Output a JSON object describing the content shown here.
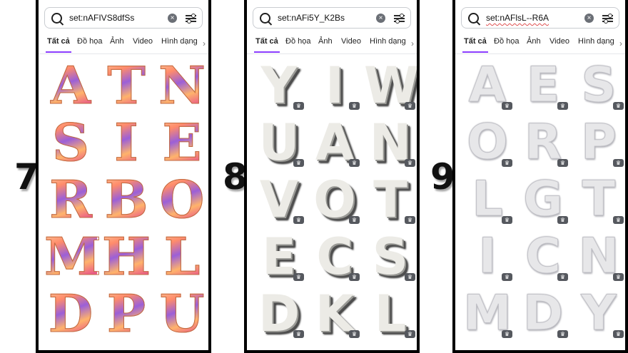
{
  "panels": [
    {
      "number": "7",
      "search_query": "set:nAFIVS8dfSs",
      "tabs": [
        "Tất cả",
        "Đồ họa",
        "Ảnh",
        "Video",
        "Hình dạng"
      ],
      "active_tab": "Tất cả",
      "letters": [
        "A",
        "T",
        "N",
        "S",
        "I",
        "E",
        "R",
        "B",
        "O",
        "M",
        "H",
        "L",
        "D",
        "P",
        "U"
      ],
      "style": "gradient-gold-purple"
    },
    {
      "number": "8",
      "search_query": "set:nAFi5Y_K2Bs",
      "tabs": [
        "Tất cả",
        "Đồ họa",
        "Ảnh",
        "Video",
        "Hình dạng"
      ],
      "active_tab": "Tất cả",
      "letters": [
        "Y",
        "I",
        "W",
        "U",
        "A",
        "N",
        "V",
        "O",
        "T",
        "E",
        "C",
        "S",
        "D",
        "K",
        "L"
      ],
      "style": "white-3d-block"
    },
    {
      "number": "9",
      "search_query": "set:nAFlsL--R6A",
      "tabs": [
        "Tất cả",
        "Đồ họa",
        "Ảnh",
        "Video",
        "Hình dạng"
      ],
      "active_tab": "Tất cả",
      "letters": [
        "A",
        "E",
        "S",
        "O",
        "R",
        "P",
        "L",
        "G",
        "T",
        "I",
        "C",
        "N",
        "M",
        "D",
        "Y"
      ],
      "style": "silver-balloon"
    }
  ],
  "icons": {
    "search": "magnifier-icon",
    "clear": "clear-circle-icon",
    "filter": "sliders-icon",
    "badge": "premium-crown-icon",
    "more": "chevron-right-icon"
  },
  "colors": {
    "accent": "#8b3dff",
    "border": "#000000"
  }
}
